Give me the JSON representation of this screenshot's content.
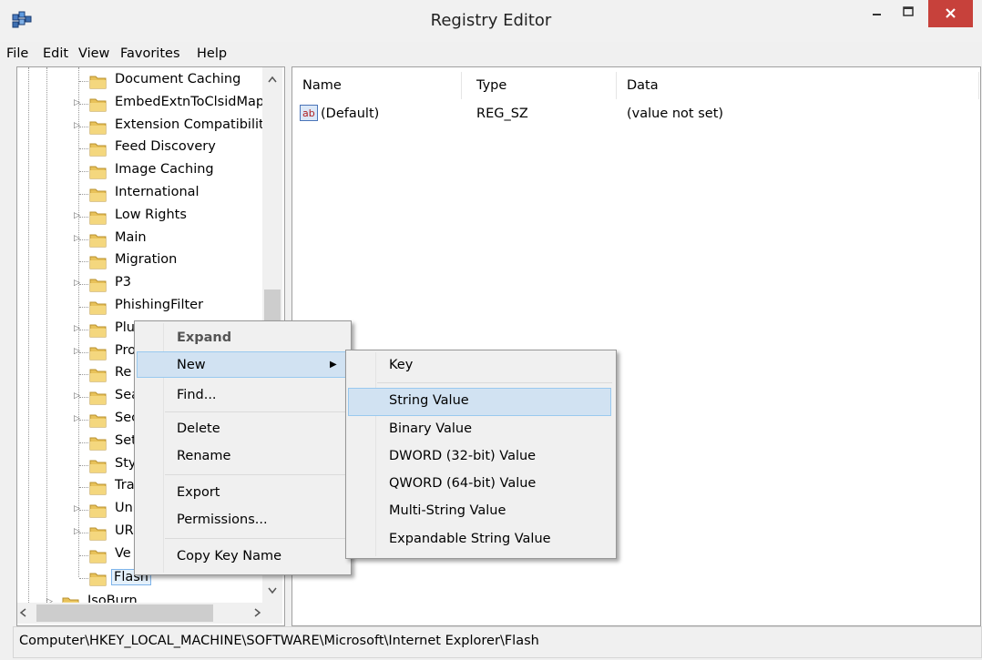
{
  "window": {
    "title": "Registry Editor"
  },
  "menubar": [
    "File",
    "Edit",
    "View",
    "Favorites",
    "Help"
  ],
  "tree": {
    "items": [
      {
        "label": "Document Caching",
        "expandable": false
      },
      {
        "label": "EmbedExtnToClsidMap",
        "expandable": true
      },
      {
        "label": "Extension Compatibility",
        "expandable": true
      },
      {
        "label": "Feed Discovery",
        "expandable": false
      },
      {
        "label": "Image Caching",
        "expandable": false
      },
      {
        "label": "International",
        "expandable": false
      },
      {
        "label": "Low Rights",
        "expandable": true
      },
      {
        "label": "Main",
        "expandable": true
      },
      {
        "label": "Migration",
        "expandable": false
      },
      {
        "label": "P3",
        "expandable": true
      },
      {
        "label": "PhishingFilter",
        "expandable": false
      },
      {
        "label": "Plu",
        "expandable": true
      },
      {
        "label": "Pro",
        "expandable": true
      },
      {
        "label": "Re",
        "expandable": false
      },
      {
        "label": "Sea",
        "expandable": true
      },
      {
        "label": "Sec",
        "expandable": true
      },
      {
        "label": "Set",
        "expandable": false
      },
      {
        "label": "Sty",
        "expandable": false
      },
      {
        "label": "Tra",
        "expandable": false
      },
      {
        "label": "Un",
        "expandable": true
      },
      {
        "label": "UR",
        "expandable": true
      },
      {
        "label": "Ve",
        "expandable": false
      },
      {
        "label": "Flash",
        "expandable": false,
        "selected": true
      }
    ],
    "parent_sibling": "IsoBurn"
  },
  "list": {
    "columns": [
      "Name",
      "Type",
      "Data"
    ],
    "rows": [
      {
        "name": "(Default)",
        "type": "REG_SZ",
        "data": "(value not set)"
      }
    ]
  },
  "context_menu": {
    "expand": "Expand",
    "new": "New",
    "find": "Find...",
    "delete": "Delete",
    "rename": "Rename",
    "export": "Export",
    "permissions": "Permissions...",
    "copy_key_name": "Copy Key Name"
  },
  "submenu": {
    "key": "Key",
    "items": [
      "String Value",
      "Binary Value",
      "DWORD (32-bit) Value",
      "QWORD (64-bit) Value",
      "Multi-String Value",
      "Expandable String Value"
    ]
  },
  "status": "Computer\\HKEY_LOCAL_MACHINE\\SOFTWARE\\Microsoft\\Internet Explorer\\Flash",
  "colors": {
    "close_button": "#c7413b",
    "highlight": "#d1e2f2",
    "highlight_border": "#99c9ef",
    "folder": "#e8c25a"
  }
}
